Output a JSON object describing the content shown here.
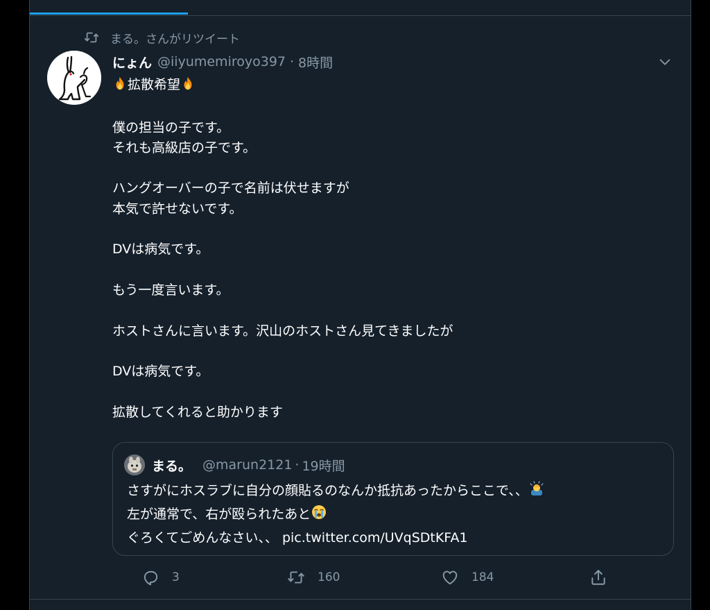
{
  "social_context": {
    "icon": "retweet-icon",
    "text": "まる。さんがリツイート"
  },
  "tweet": {
    "author_name": "にょん",
    "author_handle": "@iiyumemiroyo397",
    "separator": "·",
    "time": "8時間",
    "title_emoji": "fire-emoji",
    "title_text": "拡散希望",
    "lines": [
      "僕の担当の子です。",
      "それも高級店の子です。",
      "",
      "ハングオーバーの子で名前は伏せますが",
      "本気で許せないです。",
      "",
      "DVは病気です。",
      "",
      "もう一度言います。",
      "",
      "ホストさんに言います。沢山のホストさん見てきましたが",
      "",
      "DVは病気です。",
      "",
      "拡散してくれると助かります"
    ]
  },
  "quote": {
    "author_name": "まる。",
    "author_handle": "@marun2121",
    "separator": "·",
    "time": "19時間",
    "line1": "さすがにホスラブに自分の顔貼るのなんか抵抗あったからここで、、",
    "line1_emoji": "person-bowing-emoji",
    "line2": "左が通常で、右が殴られたあと",
    "line2_emoji": "loudly-crying-face-emoji",
    "line3": "ぐろくてごめんなさい、、 pic.twitter.com/UVqSDtKFA1"
  },
  "actions": {
    "reply_count": "3",
    "retweet_count": "160",
    "like_count": "184"
  },
  "colors": {
    "background": "#15202b",
    "border": "#38444d",
    "secondary_text": "#8899a6",
    "accent": "#1da1f2"
  }
}
